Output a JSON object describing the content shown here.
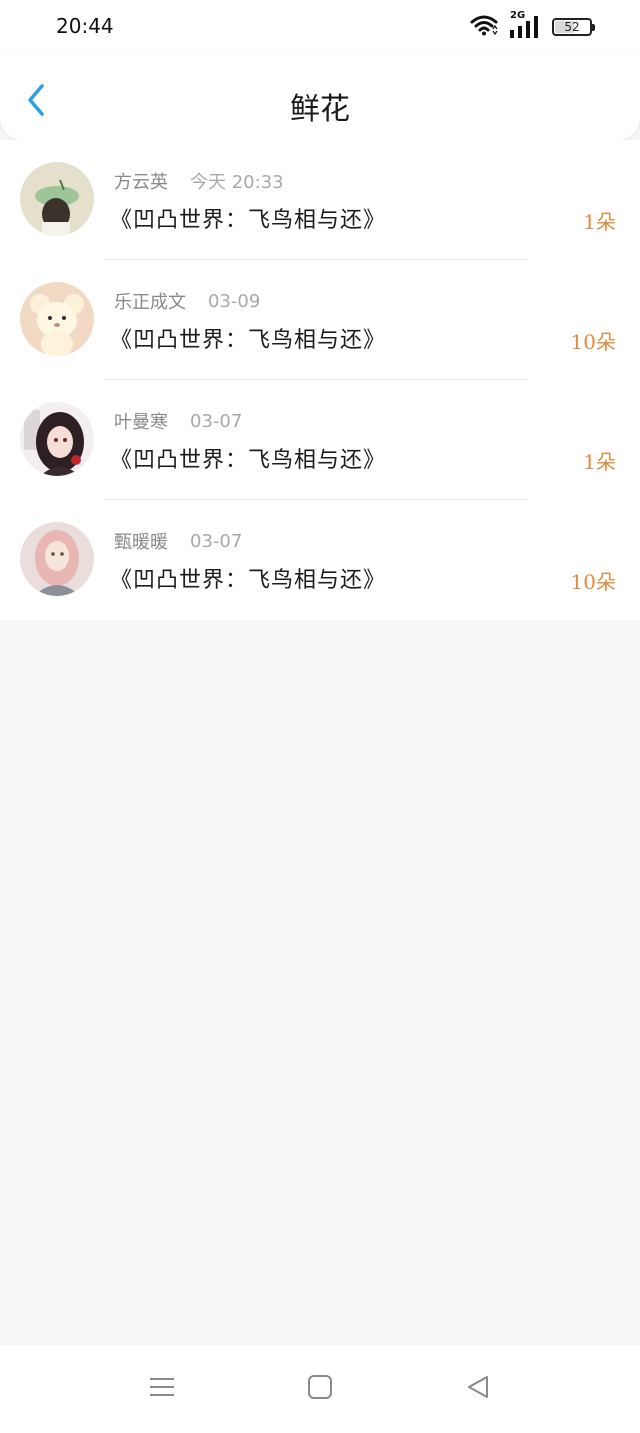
{
  "status_bar": {
    "time": "20:44",
    "network": "2G",
    "battery": "52",
    "battery_level": 0.52,
    "icons": [
      "wifi-icon",
      "signal-icon",
      "battery-icon"
    ]
  },
  "header": {
    "title": "鲜花",
    "back_icon": "chevron-left-icon",
    "accent_color": "#2b9ee8"
  },
  "flowers": [
    {
      "author": "方云英",
      "time": "今天 20:33",
      "book": "《凹凸世界：飞鸟相与还》",
      "count": "1朵",
      "avatar": "avatar-leaf-girl"
    },
    {
      "author": "乐正成文",
      "time": "03-09",
      "book": "《凹凸世界：飞鸟相与还》",
      "count": "10朵",
      "avatar": "avatar-plush-toy"
    },
    {
      "author": "叶曼寒",
      "time": "03-07",
      "book": "《凹凸世界：飞鸟相与还》",
      "count": "1朵",
      "avatar": "avatar-anime-girl"
    },
    {
      "author": "甄暖暖",
      "time": "03-07",
      "book": "《凹凸世界：飞鸟相与还》",
      "count": "10朵",
      "avatar": "avatar-pink-hair-girl"
    }
  ],
  "colors": {
    "count": "#e08a3e",
    "author": "#8a8a8a",
    "time": "#a9a9a9",
    "page_background": "#f7f6f7"
  },
  "nav_bar": {
    "icons": [
      "menu-icon",
      "home-icon",
      "back-triangle-icon"
    ]
  }
}
